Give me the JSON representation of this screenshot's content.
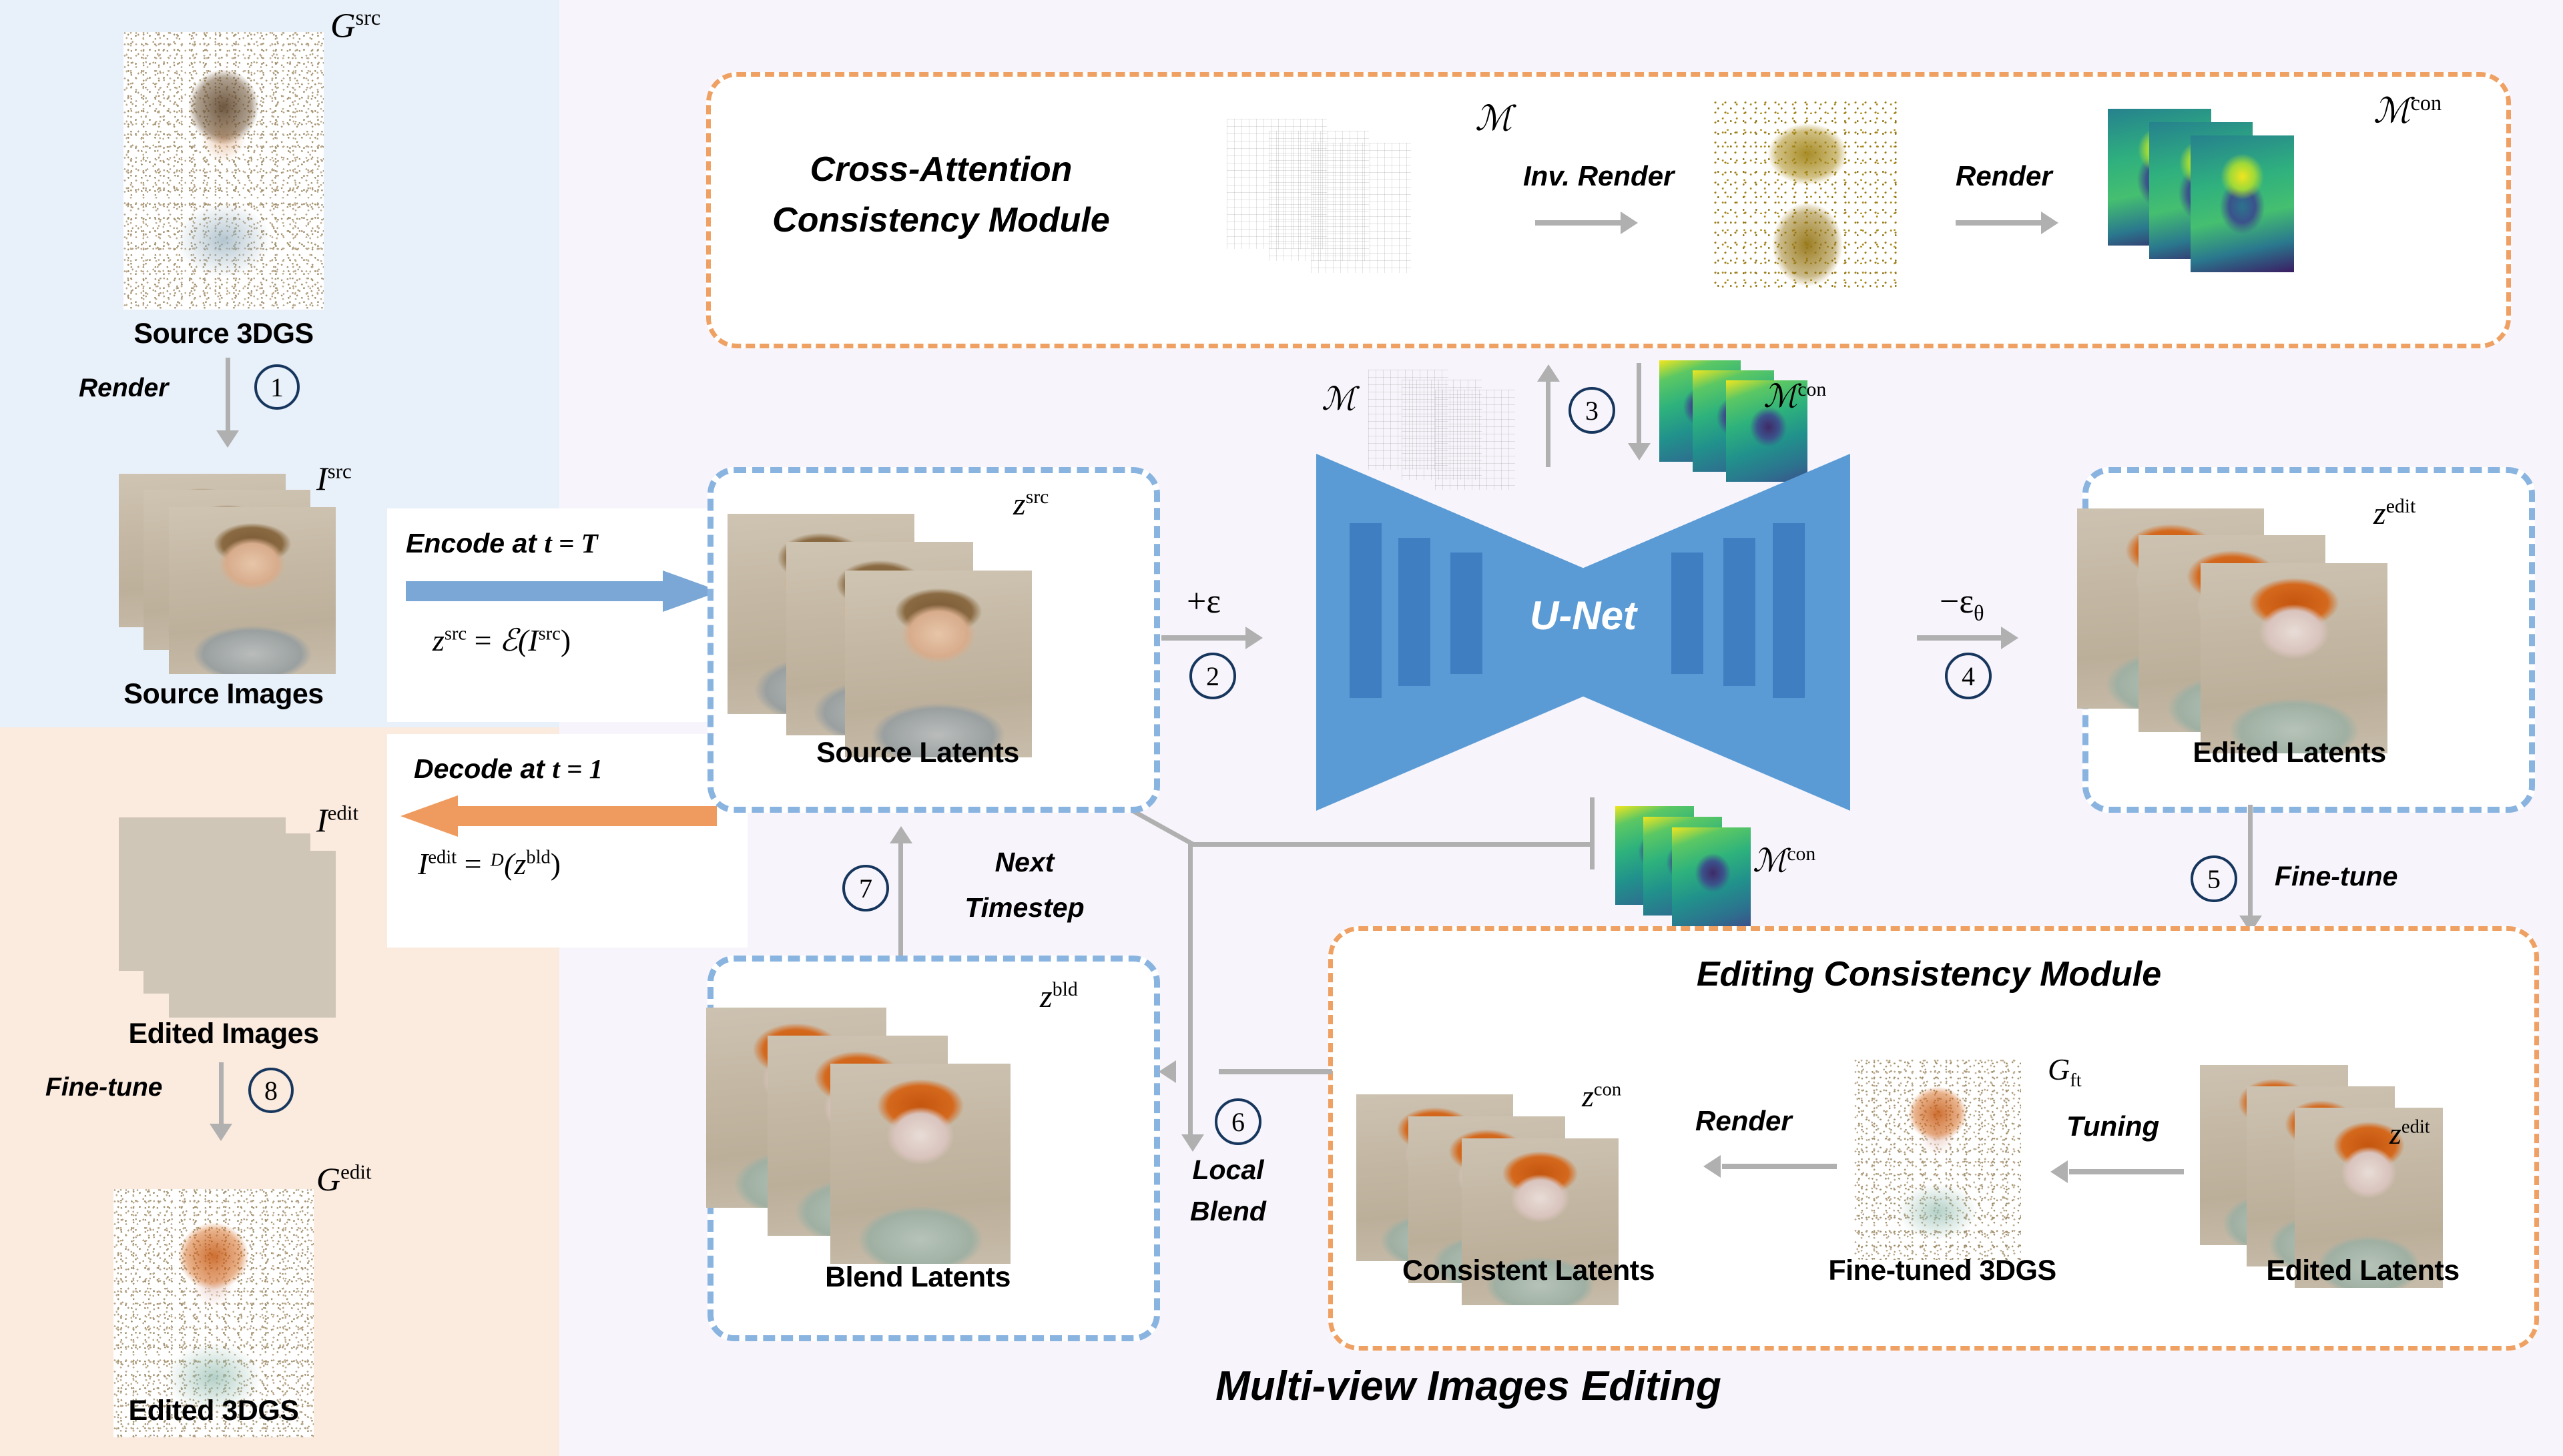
{
  "panels": {
    "source_panel_name": "Source pipeline panel",
    "edited_panel_name": "Edited pipeline panel",
    "main_panel_title": "Multi-view Images Editing"
  },
  "left_column": {
    "source_3dgs": {
      "symbol_base": "G",
      "symbol_sup": "src",
      "caption": "Source 3DGS"
    },
    "render_step": {
      "label": "Render",
      "step": "1"
    },
    "source_images": {
      "symbol_base": "I",
      "symbol_sup": "src",
      "caption": "Source Images"
    },
    "edited_images": {
      "symbol_base": "I",
      "symbol_sup": "edit",
      "caption": "Edited Images"
    },
    "finetune_step": {
      "label": "Fine-tune",
      "step": "8"
    },
    "edited_3dgs": {
      "symbol_base": "G",
      "symbol_sup": "edit",
      "caption": "Edited 3DGS"
    }
  },
  "encode_card": {
    "title_prefix": "Encode at ",
    "title_math": "t = T",
    "formula_lhs_base": "z",
    "formula_lhs_sup": "src",
    "formula_eq": " = ",
    "formula_rhs": "ℰ(I",
    "formula_rhs_sup": "src",
    "formula_rhs_close": ")"
  },
  "decode_card": {
    "title_prefix": "Decode at ",
    "title_math": "t = 1",
    "formula_lhs_base": "I",
    "formula_lhs_sup": "edit",
    "formula_eq": " = ",
    "formula_rhs": "ᴰ(z",
    "formula_rhs_sup": "bld",
    "formula_rhs_close": ")"
  },
  "cross_attention_module": {
    "title_line1": "Cross-Attention",
    "title_line2": "Consistency Module",
    "maps_label": "ℳ",
    "inv_render_label": "Inv. Render",
    "render_label": "Render",
    "maps_con_label_base": "ℳ",
    "maps_con_label_sup": "con"
  },
  "unet": {
    "label": "U-Net",
    "add_noise_label": "+ε",
    "add_noise_step": "2",
    "pred_noise_label": "−ε",
    "pred_noise_sub": "θ",
    "pred_noise_step": "4",
    "attn_in_label": "ℳ",
    "attn_out_label_base": "ℳ",
    "attn_out_label_sup": "con",
    "attn_step": "3",
    "attn_bottom_label_base": "ℳ",
    "attn_bottom_label_sup": "con"
  },
  "source_latents": {
    "symbol_base": "z",
    "symbol_sup": "src",
    "caption": "Source Latents"
  },
  "edited_latents_right": {
    "symbol_base": "z",
    "symbol_sup": "edit",
    "caption": "Edited Latents"
  },
  "blend_latents": {
    "symbol_base": "z",
    "symbol_sup": "bld",
    "caption": "Blend Latents"
  },
  "local_blend": {
    "label_line1": "Local",
    "label_line2": "Blend",
    "step": "6"
  },
  "next_timestep": {
    "label_line1": "Next",
    "label_line2": "Timestep",
    "step": "7"
  },
  "fine_tune_to_module": {
    "label": "Fine-tune",
    "step": "5"
  },
  "editing_consistency_module": {
    "title": "Editing Consistency Module",
    "consistent_latents": {
      "symbol_base": "z",
      "symbol_sup": "con",
      "caption": "Consistent Latents"
    },
    "render_label": "Render",
    "finetuned_3dgs": {
      "symbol_base": "G",
      "symbol_sub": "ft",
      "caption": "Fine-tuned 3DGS"
    },
    "tuning_label": "Tuning",
    "edited_latents": {
      "symbol_base": "z",
      "symbol_sup": "edit",
      "caption": "Edited Latents"
    }
  },
  "colors": {
    "source_panel_bg": "#e8f0f9",
    "edited_panel_bg": "#fbeade",
    "main_panel_bg": "#f7f5fb",
    "encode_arrow": "#7ba7d7",
    "decode_arrow": "#ef9b5f",
    "module_dash_orange": "#efa163",
    "latent_dash_blue": "#8ab4e0",
    "unet_fill": "#5b9bd5",
    "unet_bar": "#3f7fc1",
    "step_circle_stroke": "#17365d",
    "arrow_grey": "#b0b0b0"
  }
}
